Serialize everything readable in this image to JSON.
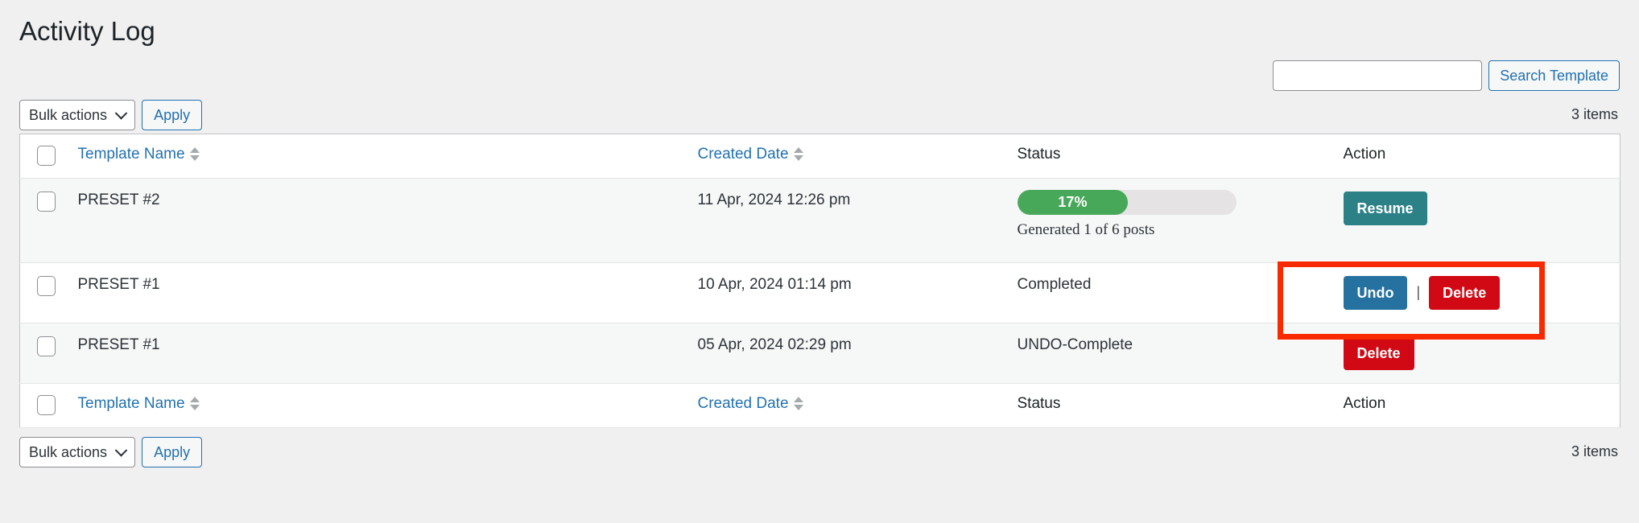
{
  "page": {
    "title": "Activity Log"
  },
  "search": {
    "value": "",
    "placeholder": "",
    "button_label": "Search Template"
  },
  "toolbar_top": {
    "bulk_label": "Bulk actions",
    "apply_label": "Apply",
    "items_count": "3 items"
  },
  "toolbar_bottom": {
    "bulk_label": "Bulk actions",
    "apply_label": "Apply",
    "items_count": "3 items"
  },
  "table": {
    "columns": {
      "name": "Template Name",
      "date": "Created Date",
      "status": "Status",
      "action": "Action"
    },
    "rows": [
      {
        "name": "PRESET #2",
        "date": "11 Apr, 2024 12:26 pm",
        "status_type": "progress",
        "progress_percent": 17,
        "progress_label": "17%",
        "progress_note": "Generated 1 of 6 posts",
        "actions": [
          "Resume"
        ]
      },
      {
        "name": "PRESET #1",
        "date": "10 Apr, 2024 01:14 pm",
        "status_type": "text",
        "status_text": "Completed",
        "actions": [
          "Undo",
          "Delete"
        ],
        "separator": "|"
      },
      {
        "name": "PRESET #1",
        "date": "05 Apr, 2024 02:29 pm",
        "status_type": "text",
        "status_text": "UNDO-Complete",
        "actions": [
          "Delete"
        ]
      }
    ]
  },
  "colors": {
    "link": "#2271b1",
    "progress_fill": "#48a85a",
    "resume": "#2b8186",
    "undo": "#2571a0",
    "delete": "#d00914",
    "annotation": "#fa2a00"
  }
}
